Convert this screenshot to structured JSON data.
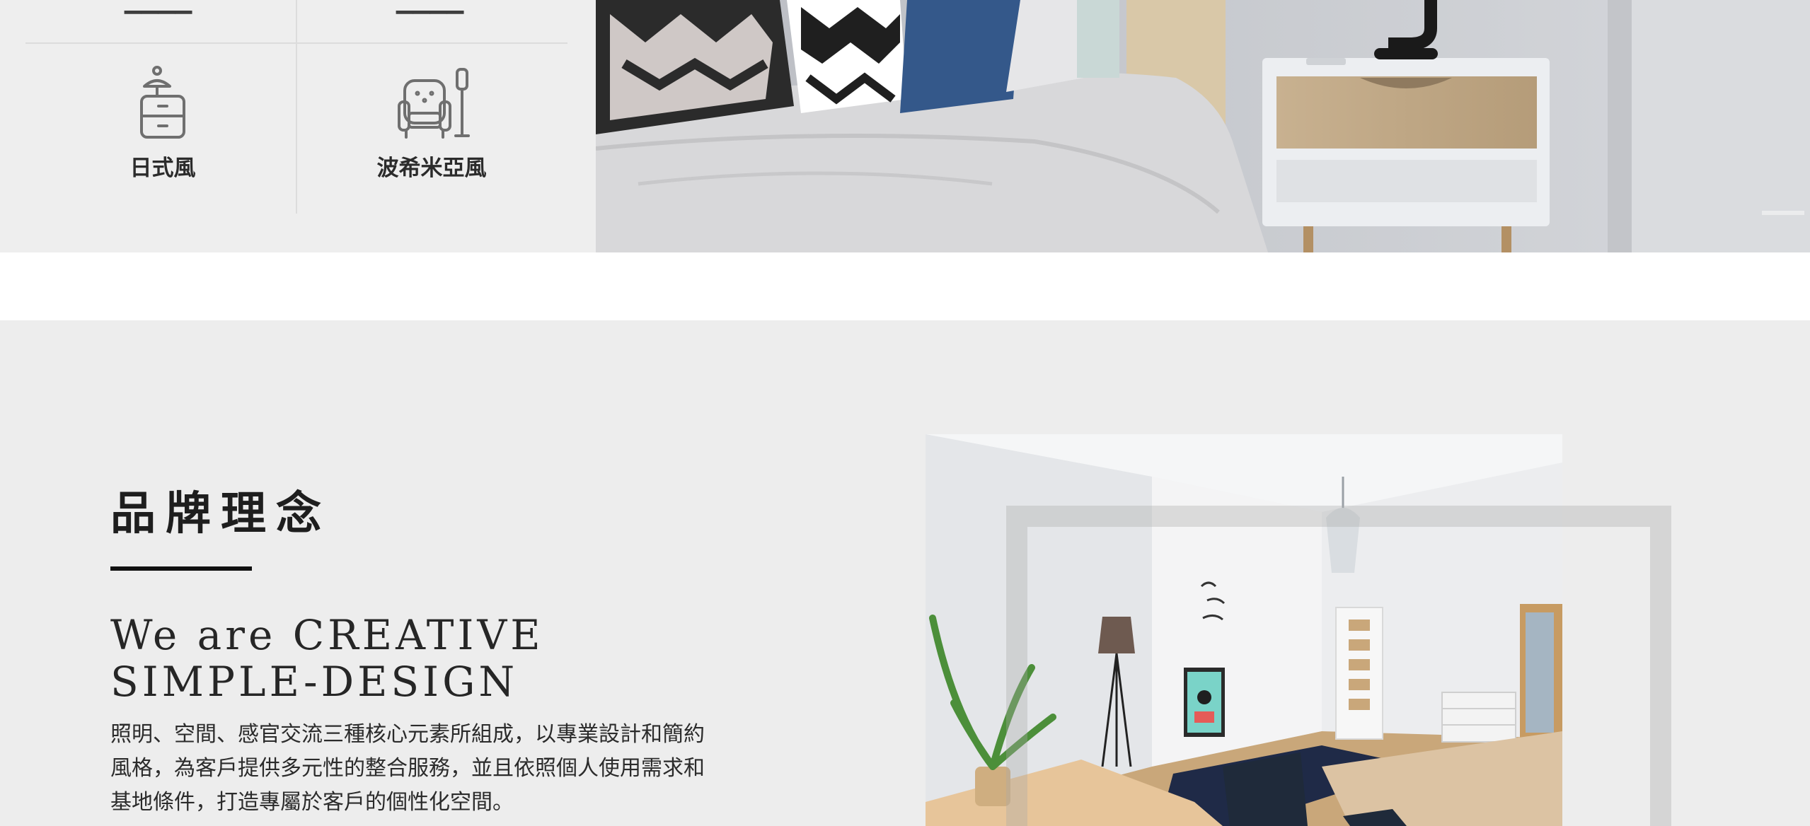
{
  "styles": {
    "items": [
      {
        "label": "日式風",
        "icon": "dresser-lamp-icon"
      },
      {
        "label": "波希米亞風",
        "icon": "armchair-floor-lamp-icon"
      }
    ]
  },
  "slider": {
    "dots": [
      "slide-1",
      "slide-2"
    ],
    "active_index": 1
  },
  "brand": {
    "title": "品牌理念",
    "subtitle_line1": "We are CREATIVE",
    "subtitle_line2": "SIMPLE-DESIGN",
    "body_line1": "照明、空間、感官交流三種核心元素所組成，以專業設計和簡約",
    "body_line2": "風格，為客戶提供多元性的整合服務，並且依照個人使用需求和",
    "body_line3": "基地條件，打造專屬於客戶的個性化空間。"
  },
  "colors": {
    "section_bg": "#ededed",
    "title_text": "#1e1e1e",
    "accent_rule": "#111111"
  }
}
